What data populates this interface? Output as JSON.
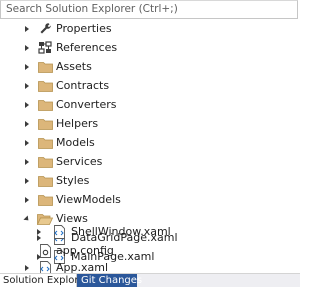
{
  "search": {
    "placeholder": "Search Solution Explorer (Ctrl+;)"
  },
  "tree": {
    "items": [
      {
        "label": "Properties",
        "icon": "wrench-icon"
      },
      {
        "label": "References",
        "icon": "references-icon"
      },
      {
        "label": "Assets",
        "icon": "folder-icon"
      },
      {
        "label": "Contracts",
        "icon": "folder-icon"
      },
      {
        "label": "Converters",
        "icon": "folder-icon"
      },
      {
        "label": "Helpers",
        "icon": "folder-icon"
      },
      {
        "label": "Models",
        "icon": "folder-icon"
      },
      {
        "label": "Services",
        "icon": "folder-icon"
      },
      {
        "label": "Styles",
        "icon": "folder-icon"
      },
      {
        "label": "ViewModels",
        "icon": "folder-icon"
      },
      {
        "label": "Views",
        "icon": "folder-open-icon",
        "expanded": true
      },
      {
        "label": "DataGridPage.xaml",
        "icon": "xaml-file-icon"
      },
      {
        "label": "MainPage.xaml",
        "icon": "xaml-file-icon"
      },
      {
        "label": "ShellWindow.xaml",
        "icon": "xaml-file-icon"
      },
      {
        "label": "app.config",
        "icon": "config-file-icon"
      },
      {
        "label": "App.xaml",
        "icon": "xaml-file-icon"
      }
    ]
  },
  "tabs": {
    "solution_explorer": "Solution Explorer",
    "git_changes": "Git Changes"
  },
  "colors": {
    "folder": "#dcb67a",
    "tab_active_bg": "#ffffff",
    "tab_inactive_bg": "#2b579a"
  }
}
